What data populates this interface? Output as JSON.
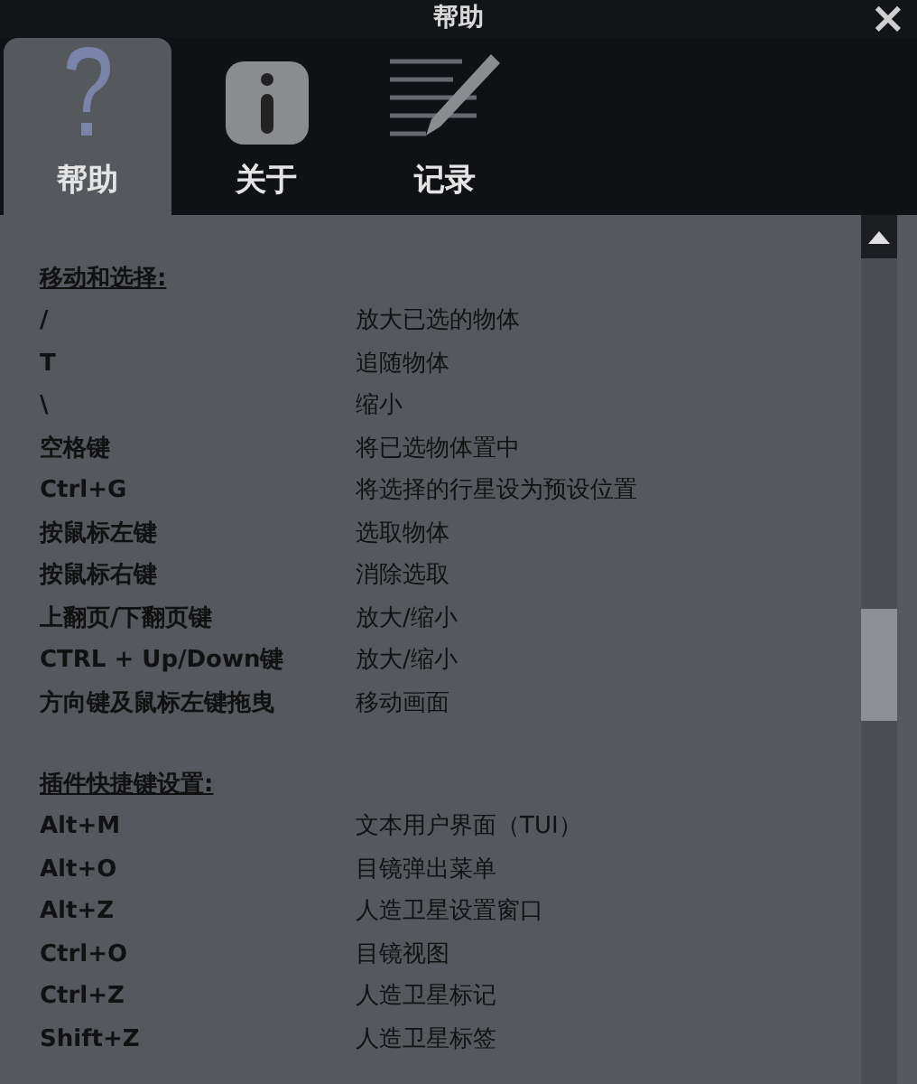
{
  "window": {
    "title": "帮助",
    "close": "×"
  },
  "tabs": [
    {
      "label": "帮助",
      "kind": "help",
      "selected": true
    },
    {
      "label": "关于",
      "kind": "about",
      "selected": false
    },
    {
      "label": "记录",
      "kind": "log",
      "selected": false
    }
  ],
  "sections": [
    {
      "heading": "移动和选择:",
      "rows": [
        {
          "key": "/",
          "action": "放大已选的物体"
        },
        {
          "key": "T",
          "action": "追随物体"
        },
        {
          "key": "\\",
          "action": "缩小"
        },
        {
          "key": "空格键",
          "action": "将已选物体置中"
        },
        {
          "key": "Ctrl+G",
          "action": "将选择的行星设为预设位置"
        },
        {
          "key": "按鼠标左键",
          "action": "选取物体"
        },
        {
          "key": "按鼠标右键",
          "action": "消除选取"
        },
        {
          "key": "上翻页/下翻页键",
          "action": "放大/缩小"
        },
        {
          "key": "CTRL + Up/Down键",
          "action": "放大/缩小"
        },
        {
          "key": "方向键及鼠标左键拖曳",
          "action": "移动画面"
        }
      ]
    },
    {
      "heading": "插件快捷键设置:",
      "rows": [
        {
          "key": "Alt+M",
          "action": "文本用户界面（TUI）"
        },
        {
          "key": "Alt+O",
          "action": "目镜弹出菜单"
        },
        {
          "key": "Alt+Z",
          "action": "人造卫星设置窗口"
        },
        {
          "key": "Ctrl+O",
          "action": "目镜视图"
        },
        {
          "key": "Ctrl+Z",
          "action": "人造卫星标记"
        },
        {
          "key": "Shift+Z",
          "action": "人造卫星标签"
        }
      ]
    }
  ]
}
